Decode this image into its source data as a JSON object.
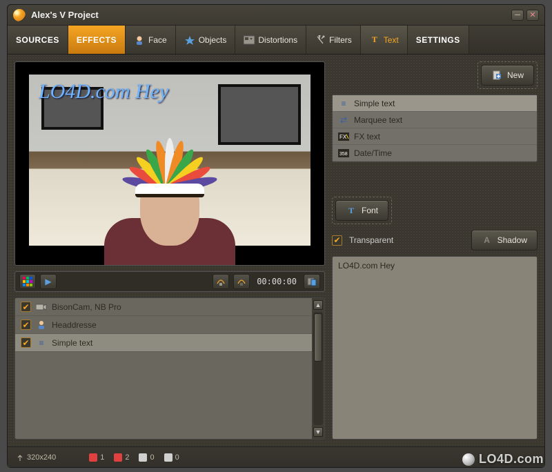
{
  "title": "Alex's V Project",
  "tabs": {
    "sources": "SOURCES",
    "effects": "EFFECTS",
    "face": "Face",
    "objects": "Objects",
    "distortions": "Distortions",
    "filters": "Filters",
    "text": "Text",
    "settings": "SETTINGS"
  },
  "preview": {
    "overlay_text": "LO4D.com Hey"
  },
  "toolbar": {
    "timecode": "00:00:00"
  },
  "layers": [
    {
      "label": "BisonCam, NB Pro",
      "checked": true,
      "icon": "camera"
    },
    {
      "label": "Headdresse",
      "checked": true,
      "icon": "person"
    },
    {
      "label": "Simple text",
      "checked": true,
      "icon": "text-lines"
    }
  ],
  "right": {
    "new_btn": "New",
    "text_styles": [
      {
        "label": "Simple text",
        "icon": "text-lines"
      },
      {
        "label": "Marquee text",
        "icon": "marquee"
      },
      {
        "label": "FX text",
        "icon": "fx"
      },
      {
        "label": "Date/Time",
        "icon": "date"
      }
    ],
    "font_btn": "Font",
    "transparent_label": "Transparent",
    "transparent_checked": true,
    "shadow_btn": "Shadow",
    "text_value": "LO4D.com Hey"
  },
  "status": {
    "resolution": "320x240",
    "counters": [
      {
        "color": "#e04040",
        "value": "1"
      },
      {
        "color": "#e04040",
        "value": "2"
      },
      {
        "color": "#d0d0d0",
        "value": "0"
      },
      {
        "color": "#d0d0d0",
        "value": "0"
      }
    ]
  },
  "watermark": "LO4D.com"
}
